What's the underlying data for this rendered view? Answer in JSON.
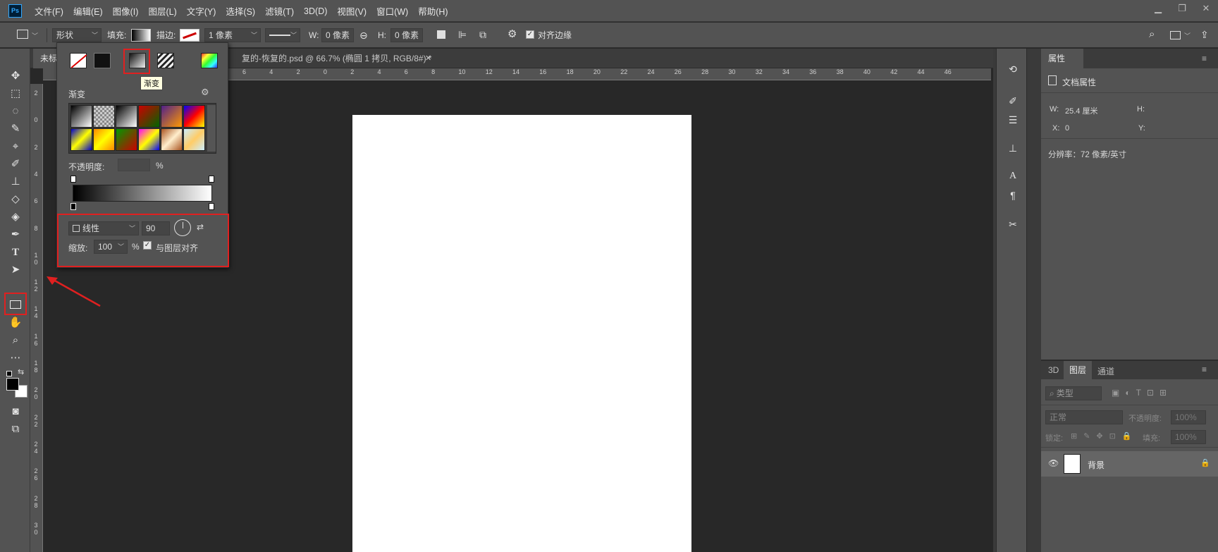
{
  "menubar": {
    "logo": "Ps",
    "items": [
      "文件(F)",
      "编辑(E)",
      "图像(I)",
      "图层(L)",
      "文字(Y)",
      "选择(S)",
      "滤镜(T)",
      "3D(D)",
      "视图(V)",
      "窗口(W)",
      "帮助(H)"
    ]
  },
  "options": {
    "mode": "形状",
    "fill_label": "填充:",
    "stroke_label": "描边:",
    "stroke_width": "1 像素",
    "w_label": "W:",
    "w_value": "0 像素",
    "h_label": "H:",
    "h_value": "0 像素",
    "align_edges": "对齐边缘"
  },
  "tabs": {
    "active": "未标",
    "second": "复的-恢复的.psd @ 66.7% (椭圆 1 拷贝, RGB/8#) *"
  },
  "ruler_h": [
    "6",
    "4",
    "2",
    "0",
    "2",
    "4",
    "6",
    "8",
    "10",
    "12",
    "14",
    "16",
    "18",
    "20",
    "22",
    "24",
    "26",
    "28",
    "30",
    "32",
    "34",
    "36",
    "38",
    "40",
    "42",
    "44",
    "46"
  ],
  "ruler_v": [
    "2",
    "0",
    "2",
    "4",
    "6",
    "8",
    "1 0",
    "1 2",
    "1 4",
    "1 6",
    "1 8",
    "2 0",
    "2 2",
    "2 4",
    "2 6",
    "2 8",
    "3 0"
  ],
  "popup": {
    "tooltip": "渐变",
    "section_label": "渐变",
    "opacity_label": "不透明度:",
    "opacity_unit": "%",
    "gradient_type": "线性",
    "angle": "90",
    "scale_label": "缩放:",
    "scale_value": "100",
    "scale_unit": "%",
    "align_layer": "与图层对齐"
  },
  "properties": {
    "title": "属性",
    "doc_props": "文档属性",
    "w_label": "W:",
    "w_value": "25.4 厘米",
    "h_label": "H:",
    "x_label": "X:",
    "x_value": "0",
    "y_label": "Y:",
    "resolution": "分辨率：72 像素/英寸"
  },
  "layers": {
    "tabs": [
      "3D",
      "图层",
      "通道"
    ],
    "filter": "类型",
    "blend": "正常",
    "opacity_label": "不透明度:",
    "opacity_value": "100%",
    "lock_label": "锁定:",
    "fill_label": "填充:",
    "fill_value": "100%",
    "layer_name": "背景"
  },
  "colors": {
    "bg": "#282828",
    "panel": "#535353",
    "highlight": "#e02020"
  }
}
